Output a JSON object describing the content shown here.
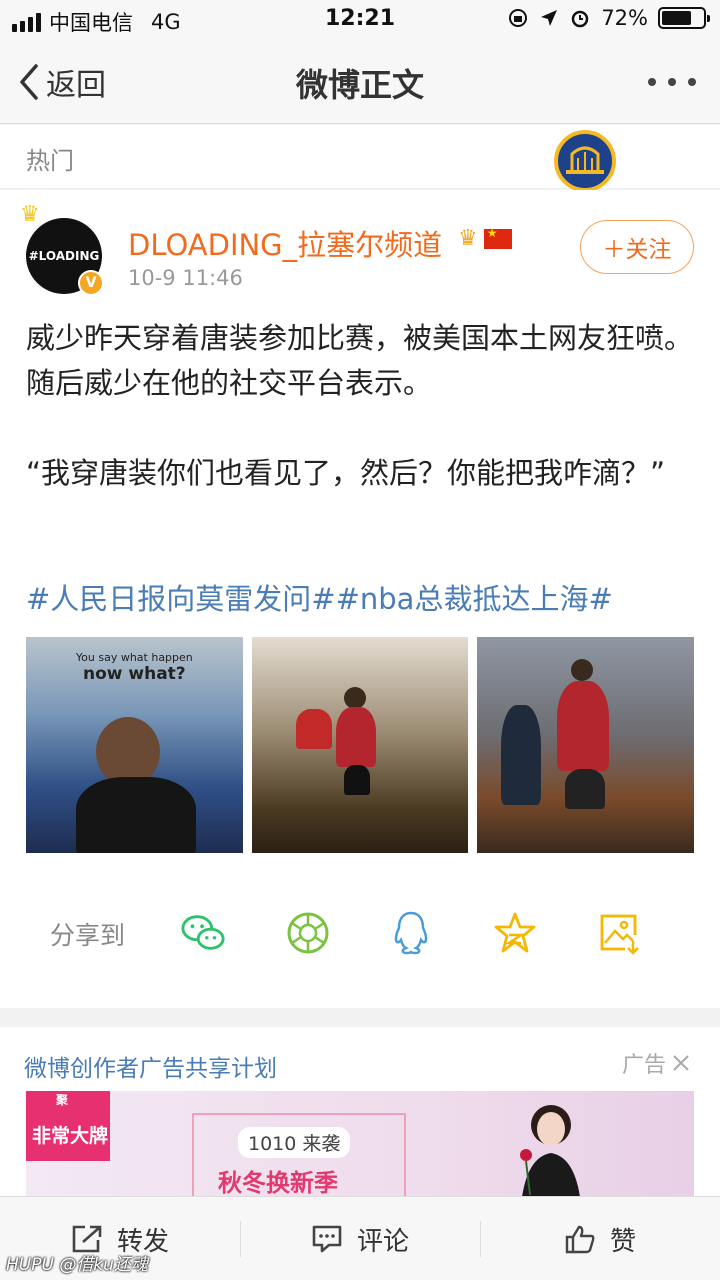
{
  "status_bar": {
    "carrier": "中国电信",
    "network": "4G",
    "time": "12:21",
    "battery": "72%",
    "battery_level": 0.72
  },
  "nav": {
    "back_label": "返回",
    "title": "微博正文"
  },
  "hot": {
    "label": "热门"
  },
  "post": {
    "avatar_text": "#LOADING",
    "verified_badge": "V",
    "user_name": "DLOADING_拉塞尔频道",
    "time": "10-9 11:46",
    "follow_label": "＋关注",
    "text": "威少昨天穿着唐装参加比赛，被美国本土网友狂喷。随后威少在他的社交平台表示。\n\n“我穿唐装你们也看见了，然后？你能把我咋滴？”",
    "tags": "#人民日报向莫雷发问##nba总裁抵达上海#",
    "photo_caption_small": "You say what happen",
    "photo_caption_big": "now what?"
  },
  "share": {
    "label": "分享到",
    "icons": [
      "wechat-icon",
      "moments-icon",
      "qq-icon",
      "qzone-icon",
      "save-image-icon"
    ]
  },
  "ad": {
    "title": "微博创作者广告共享计划",
    "tag": "广告",
    "brand_top": "聚",
    "brand": "非常大牌",
    "promo_1010": "1010 来袭",
    "promo_season": "秋冬换新季"
  },
  "actions": {
    "repost": "转发",
    "comment": "评论",
    "like": "赞"
  },
  "watermark": "HUPU @借ku还魂",
  "colors": {
    "accent_orange": "#f26b1d",
    "link_blue": "#4a7cb6",
    "share_green": "#2dc26b",
    "share_blue": "#4a9bd9",
    "share_yellow": "#f5b800"
  }
}
